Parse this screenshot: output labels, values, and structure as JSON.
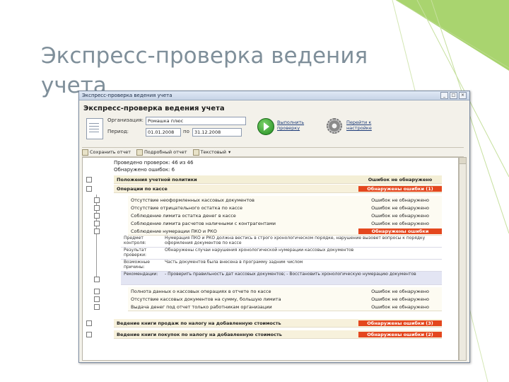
{
  "slide": {
    "title": "Экспресс-проверка ведения учета"
  },
  "window": {
    "title": "Экспресс-проверка ведения учета",
    "buttons": [
      "_",
      "□",
      "×"
    ]
  },
  "form": {
    "heading": "Экспресс-проверка ведения учета",
    "org_label": "Организация:",
    "org_value": "Ромашка плюс",
    "period_label": "Период:",
    "date_from": "01.01.2008",
    "date_sep": "по",
    "date_to": "31.12.2008",
    "run_link": "Выполнить проверку",
    "settings_link": "Перейти к настройке"
  },
  "toolbar": {
    "save_label": "Сохранить отчет",
    "full_label": "Подробный отчет",
    "text_label": "Текстовый"
  },
  "report": {
    "summary1": "Проведено проверок: 46 из 46",
    "summary2": "Обнаружено ошибок: 6",
    "header": {
      "name": "Положения учетной политики",
      "status": "Ошибок не обнаружено"
    },
    "cash_group": {
      "name": "Операции по кассе",
      "status": "Обнаружены ошибки (1)"
    },
    "cash_checks": [
      {
        "name": "Отсутствие неоформленных кассовых документов",
        "status": "Ошибок не обнаружено"
      },
      {
        "name": "Отсутствие отрицательного остатка по кассе",
        "status": "Ошибок не обнаружено"
      },
      {
        "name": "Соблюдение лимита остатка денег в кассе",
        "status": "Ошибок не обнаружено"
      },
      {
        "name": "Соблюдение лимита расчетов наличными с контрагентами",
        "status": "Ошибок не обнаружено"
      },
      {
        "name": "Соблюдение нумерации ПКО и РКО",
        "status": "Обнаружены ошибки"
      }
    ],
    "details": [
      {
        "k": "Предмет контроля:",
        "v": "Нумерация ПКО и РКО должна вестись в строго хронологическом порядке, нарушение вызовет вопросы к порядку оформления документов по кассе"
      },
      {
        "k": "Результат проверки:",
        "v": "Обнаружены случаи нарушения хронологической нумерации кассовых документов"
      },
      {
        "k": "Возможные причины:",
        "v": "Часть документов была внесена в программу задним числом"
      },
      {
        "k": "Рекомендации:",
        "v": "- Проверить правильность дат кассовых документов; - Восстановить хронологическую нумерацию документов"
      }
    ],
    "more_checks": [
      {
        "name": "Полнота данных о кассовых операциях в отчете по кассе",
        "status": "Ошибок не обнаружено"
      },
      {
        "name": "Отсутствие кассовых документов на сумму, большую лимита",
        "status": "Ошибок не обнаружено"
      },
      {
        "name": "Выдача денег под отчет только работникам организации",
        "status": "Ошибок не обнаружено"
      }
    ],
    "sales_group": {
      "name": "Ведение книги продаж по налогу на добавленную стоимость",
      "status": "Обнаружены ошибки (3)"
    },
    "purchase_group": {
      "name": "Ведение книги покупок по налогу на добавленную стоимость",
      "status": "Обнаружены ошибки (2)"
    }
  },
  "colors": {
    "error": "#e4471e",
    "accent_green": "#8cc63f",
    "title_gray": "#7f8f9a"
  }
}
